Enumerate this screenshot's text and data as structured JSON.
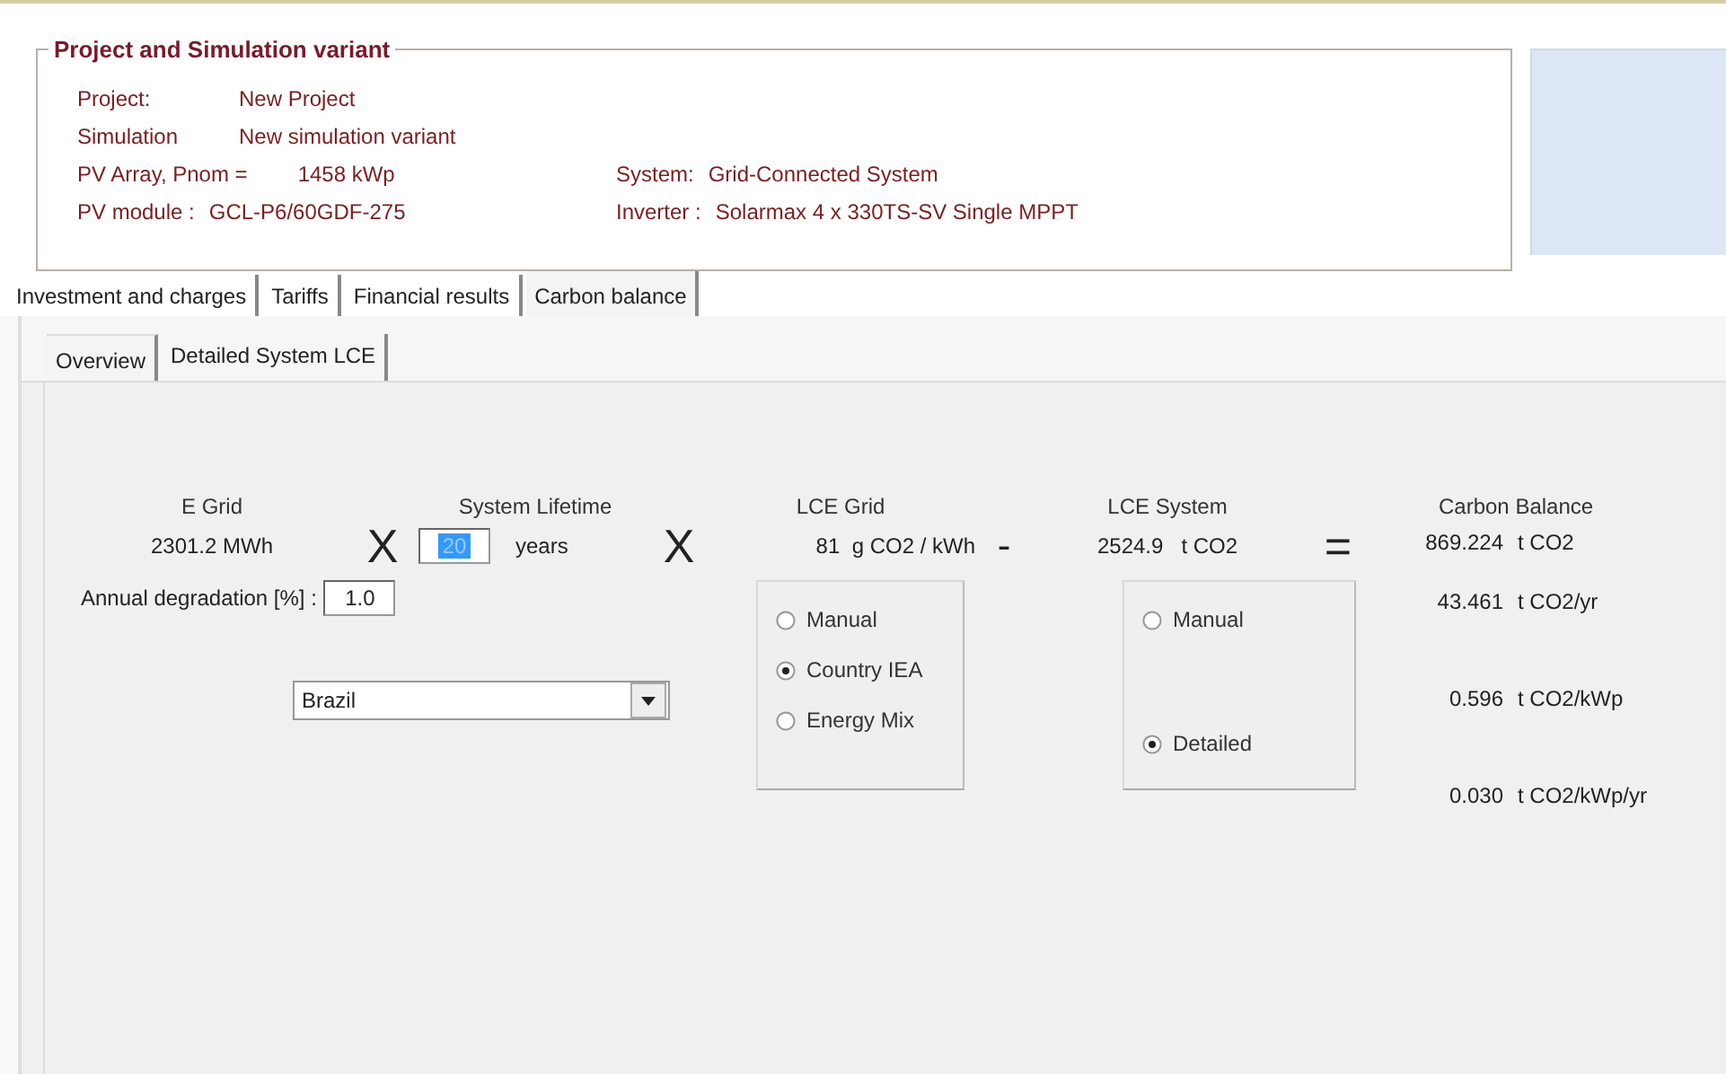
{
  "project_box": {
    "title": "Project and Simulation variant",
    "left_rows": [
      {
        "label": "Project:",
        "value": "New Project"
      },
      {
        "label": "Simulation",
        "value": "New simulation variant"
      },
      {
        "label": "PV Array, Pnom =",
        "value": "1458 kWp"
      },
      {
        "label": "PV module :",
        "value": "GCL-P6/60GDF-275"
      }
    ],
    "right_rows": [
      {
        "label": "System:",
        "value": "Grid-Connected System"
      },
      {
        "label": "Inverter :",
        "value": "Solarmax 4 x 330TS-SV Single MPPT"
      }
    ]
  },
  "tabs": [
    {
      "label": "Investment and charges",
      "selected": false
    },
    {
      "label": "Tariffs",
      "selected": false
    },
    {
      "label": "Financial results",
      "selected": false
    },
    {
      "label": "Carbon balance",
      "selected": true
    }
  ],
  "sub_tabs": [
    {
      "label": "Overview",
      "selected": true
    },
    {
      "label": "Detailed System LCE",
      "selected": false
    }
  ],
  "calc": {
    "e_grid": {
      "label": "E Grid",
      "value": "2301.2 MWh"
    },
    "operators": [
      "X",
      "X",
      "-",
      "="
    ],
    "lifetime": {
      "label": "System Lifetime",
      "value": "20",
      "text_selected": true,
      "unit": "years"
    },
    "lce_grid": {
      "label": "LCE Grid",
      "value": "81",
      "unit": "g CO2 / kWh"
    },
    "lce_system": {
      "label": "LCE System",
      "value": "2524.9",
      "unit": "t CO2"
    },
    "carbon_balance": {
      "label": "Carbon Balance",
      "lines": [
        {
          "value": "869.224",
          "unit": "t CO2"
        },
        {
          "value": "43.461",
          "unit": "t CO2/yr"
        },
        {
          "value": "0.596",
          "unit": "t CO2/kWp"
        },
        {
          "value": "0.030",
          "unit": "t CO2/kWp/yr"
        }
      ]
    },
    "degradation": {
      "label": "Annual degradation [%] :",
      "value": "1.0"
    },
    "country": {
      "value": "Brazil"
    },
    "grid_options": [
      {
        "label": "Manual",
        "selected": false
      },
      {
        "label": "Country IEA",
        "selected": true
      },
      {
        "label": "Energy Mix",
        "selected": false
      }
    ],
    "system_options": [
      {
        "label": "Manual",
        "selected": false
      },
      {
        "label": "Detailed",
        "selected": true
      }
    ]
  }
}
